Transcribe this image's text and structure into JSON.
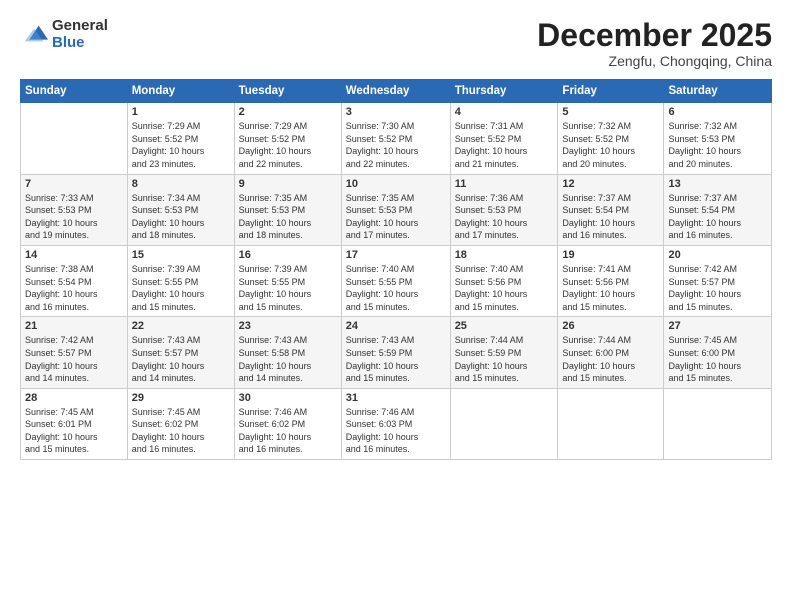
{
  "logo": {
    "general": "General",
    "blue": "Blue"
  },
  "header": {
    "month": "December 2025",
    "location": "Zengfu, Chongqing, China"
  },
  "weekdays": [
    "Sunday",
    "Monday",
    "Tuesday",
    "Wednesday",
    "Thursday",
    "Friday",
    "Saturday"
  ],
  "weeks": [
    [
      {
        "day": "",
        "detail": ""
      },
      {
        "day": "1",
        "detail": "Sunrise: 7:29 AM\nSunset: 5:52 PM\nDaylight: 10 hours\nand 23 minutes."
      },
      {
        "day": "2",
        "detail": "Sunrise: 7:29 AM\nSunset: 5:52 PM\nDaylight: 10 hours\nand 22 minutes."
      },
      {
        "day": "3",
        "detail": "Sunrise: 7:30 AM\nSunset: 5:52 PM\nDaylight: 10 hours\nand 22 minutes."
      },
      {
        "day": "4",
        "detail": "Sunrise: 7:31 AM\nSunset: 5:52 PM\nDaylight: 10 hours\nand 21 minutes."
      },
      {
        "day": "5",
        "detail": "Sunrise: 7:32 AM\nSunset: 5:52 PM\nDaylight: 10 hours\nand 20 minutes."
      },
      {
        "day": "6",
        "detail": "Sunrise: 7:32 AM\nSunset: 5:53 PM\nDaylight: 10 hours\nand 20 minutes."
      }
    ],
    [
      {
        "day": "7",
        "detail": "Sunrise: 7:33 AM\nSunset: 5:53 PM\nDaylight: 10 hours\nand 19 minutes."
      },
      {
        "day": "8",
        "detail": "Sunrise: 7:34 AM\nSunset: 5:53 PM\nDaylight: 10 hours\nand 18 minutes."
      },
      {
        "day": "9",
        "detail": "Sunrise: 7:35 AM\nSunset: 5:53 PM\nDaylight: 10 hours\nand 18 minutes."
      },
      {
        "day": "10",
        "detail": "Sunrise: 7:35 AM\nSunset: 5:53 PM\nDaylight: 10 hours\nand 17 minutes."
      },
      {
        "day": "11",
        "detail": "Sunrise: 7:36 AM\nSunset: 5:53 PM\nDaylight: 10 hours\nand 17 minutes."
      },
      {
        "day": "12",
        "detail": "Sunrise: 7:37 AM\nSunset: 5:54 PM\nDaylight: 10 hours\nand 16 minutes."
      },
      {
        "day": "13",
        "detail": "Sunrise: 7:37 AM\nSunset: 5:54 PM\nDaylight: 10 hours\nand 16 minutes."
      }
    ],
    [
      {
        "day": "14",
        "detail": "Sunrise: 7:38 AM\nSunset: 5:54 PM\nDaylight: 10 hours\nand 16 minutes."
      },
      {
        "day": "15",
        "detail": "Sunrise: 7:39 AM\nSunset: 5:55 PM\nDaylight: 10 hours\nand 15 minutes."
      },
      {
        "day": "16",
        "detail": "Sunrise: 7:39 AM\nSunset: 5:55 PM\nDaylight: 10 hours\nand 15 minutes."
      },
      {
        "day": "17",
        "detail": "Sunrise: 7:40 AM\nSunset: 5:55 PM\nDaylight: 10 hours\nand 15 minutes."
      },
      {
        "day": "18",
        "detail": "Sunrise: 7:40 AM\nSunset: 5:56 PM\nDaylight: 10 hours\nand 15 minutes."
      },
      {
        "day": "19",
        "detail": "Sunrise: 7:41 AM\nSunset: 5:56 PM\nDaylight: 10 hours\nand 15 minutes."
      },
      {
        "day": "20",
        "detail": "Sunrise: 7:42 AM\nSunset: 5:57 PM\nDaylight: 10 hours\nand 15 minutes."
      }
    ],
    [
      {
        "day": "21",
        "detail": "Sunrise: 7:42 AM\nSunset: 5:57 PM\nDaylight: 10 hours\nand 14 minutes."
      },
      {
        "day": "22",
        "detail": "Sunrise: 7:43 AM\nSunset: 5:57 PM\nDaylight: 10 hours\nand 14 minutes."
      },
      {
        "day": "23",
        "detail": "Sunrise: 7:43 AM\nSunset: 5:58 PM\nDaylight: 10 hours\nand 14 minutes."
      },
      {
        "day": "24",
        "detail": "Sunrise: 7:43 AM\nSunset: 5:59 PM\nDaylight: 10 hours\nand 15 minutes."
      },
      {
        "day": "25",
        "detail": "Sunrise: 7:44 AM\nSunset: 5:59 PM\nDaylight: 10 hours\nand 15 minutes."
      },
      {
        "day": "26",
        "detail": "Sunrise: 7:44 AM\nSunset: 6:00 PM\nDaylight: 10 hours\nand 15 minutes."
      },
      {
        "day": "27",
        "detail": "Sunrise: 7:45 AM\nSunset: 6:00 PM\nDaylight: 10 hours\nand 15 minutes."
      }
    ],
    [
      {
        "day": "28",
        "detail": "Sunrise: 7:45 AM\nSunset: 6:01 PM\nDaylight: 10 hours\nand 15 minutes."
      },
      {
        "day": "29",
        "detail": "Sunrise: 7:45 AM\nSunset: 6:02 PM\nDaylight: 10 hours\nand 16 minutes."
      },
      {
        "day": "30",
        "detail": "Sunrise: 7:46 AM\nSunset: 6:02 PM\nDaylight: 10 hours\nand 16 minutes."
      },
      {
        "day": "31",
        "detail": "Sunrise: 7:46 AM\nSunset: 6:03 PM\nDaylight: 10 hours\nand 16 minutes."
      },
      {
        "day": "",
        "detail": ""
      },
      {
        "day": "",
        "detail": ""
      },
      {
        "day": "",
        "detail": ""
      }
    ]
  ]
}
